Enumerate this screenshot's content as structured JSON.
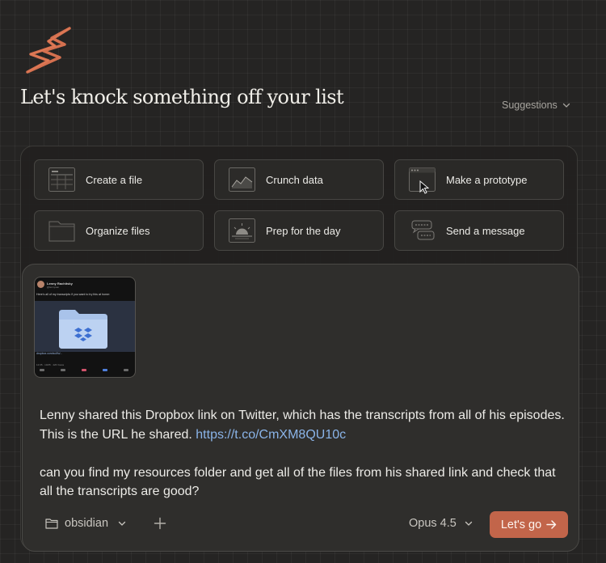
{
  "brand": {
    "logo_icon": "bolt-s-logo-icon",
    "accent": "#d4704f"
  },
  "header": {
    "title": "Let's knock something off your list",
    "suggestions_label": "Suggestions"
  },
  "quick_actions": [
    {
      "label": "Create a file",
      "icon": "spreadsheet-icon"
    },
    {
      "label": "Crunch data",
      "icon": "chart-icon"
    },
    {
      "label": "Make a prototype",
      "icon": "browser-window-icon"
    },
    {
      "label": "Organize files",
      "icon": "folder-icon"
    },
    {
      "label": "Prep for the day",
      "icon": "sunrise-icon"
    },
    {
      "label": "Send a message",
      "icon": "chat-bubbles-icon"
    }
  ],
  "composer": {
    "attachment": {
      "type": "screenshot",
      "author": "Lenny Rachitsky",
      "handle": "@lennysan",
      "tweet_text": "Here's all of my transcripts if you want to try this at home:",
      "link_text": "dropbox.com/scl/fo/...",
      "meta_text": "12:05 · 10/25 · 426 Views"
    },
    "message_line1": "Lenny shared this Dropbox link on Twitter, which has the transcripts from all of his episodes. This is the URL he shared. ",
    "message_link": "https://t.co/CmXM8QU10c",
    "message_line2": "can you find my resources folder and get all of the files from his shared link and check that all the transcripts are good?",
    "project_label": "obsidian",
    "model_label": "Opus 4.5",
    "submit_label": "Let's go",
    "submit_color": "#c2654a",
    "link_color": "#8ab4e8"
  }
}
